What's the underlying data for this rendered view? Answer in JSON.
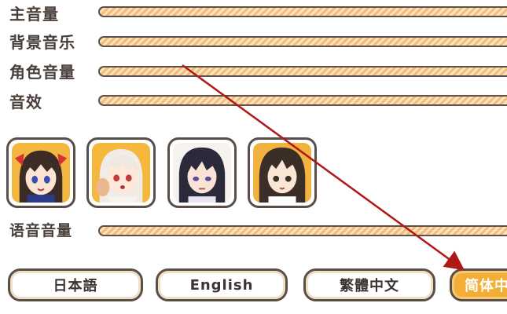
{
  "volume": {
    "master_label": "主音量",
    "bgm_label": "背景音乐",
    "character_label": "角色音量",
    "sfx_label": "音效",
    "voice_label": "语音音量"
  },
  "languages": {
    "japanese": "日本語",
    "english": "English",
    "traditional_chinese": "繁體中文",
    "simplified_chinese": "简体中文"
  },
  "colors": {
    "slider_fill": "#f6c98f",
    "slider_border": "#5d5049",
    "active_button": "#f2ae36",
    "annotation_arrow": "#b01818"
  }
}
